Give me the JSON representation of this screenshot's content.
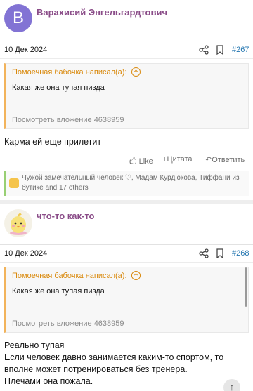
{
  "post1": {
    "avatar_letter": "В",
    "author": "Варахисий Энгельгардтович",
    "date": "10 Дек 2024",
    "number": "#267",
    "quote": {
      "header": "Помоечная бабочка написал(а):",
      "body": "Какая же она тупая пизда",
      "attachment": "Посмотреть вложение 4638959"
    },
    "message": "Карма ей еще прилетит",
    "actions": {
      "like": "Like",
      "quote": "Цитата",
      "reply": "Ответить"
    },
    "reactions": "Чужой замечательный человек ♡, Мадам Курдюкова, Тиффани из бутике and 17 others"
  },
  "post2": {
    "author": "что-то как-то",
    "date": "10 Дек 2024",
    "number": "#268",
    "quote": {
      "header": "Помоечная бабочка написал(а):",
      "body": "Какая же она тупая пизда",
      "attachment": "Посмотреть вложение 4638959"
    },
    "message_lines": [
      "Реально тупая",
      "Если человек давно занимается каким-то спортом, то",
      "вполне может потренироваться без тренера.",
      "Плечами она пожала."
    ]
  },
  "colors": {
    "author": "#8a4c88",
    "quote_accent": "#f2b35b",
    "link": "#2577b1",
    "reactions_accent": "#98cf73"
  },
  "icons": [
    "share-icon",
    "bookmark-icon",
    "arrow-up-circle-icon",
    "like-icon",
    "plus-icon",
    "reply-icon",
    "thumbs-up-icon",
    "scroll-up-icon"
  ]
}
